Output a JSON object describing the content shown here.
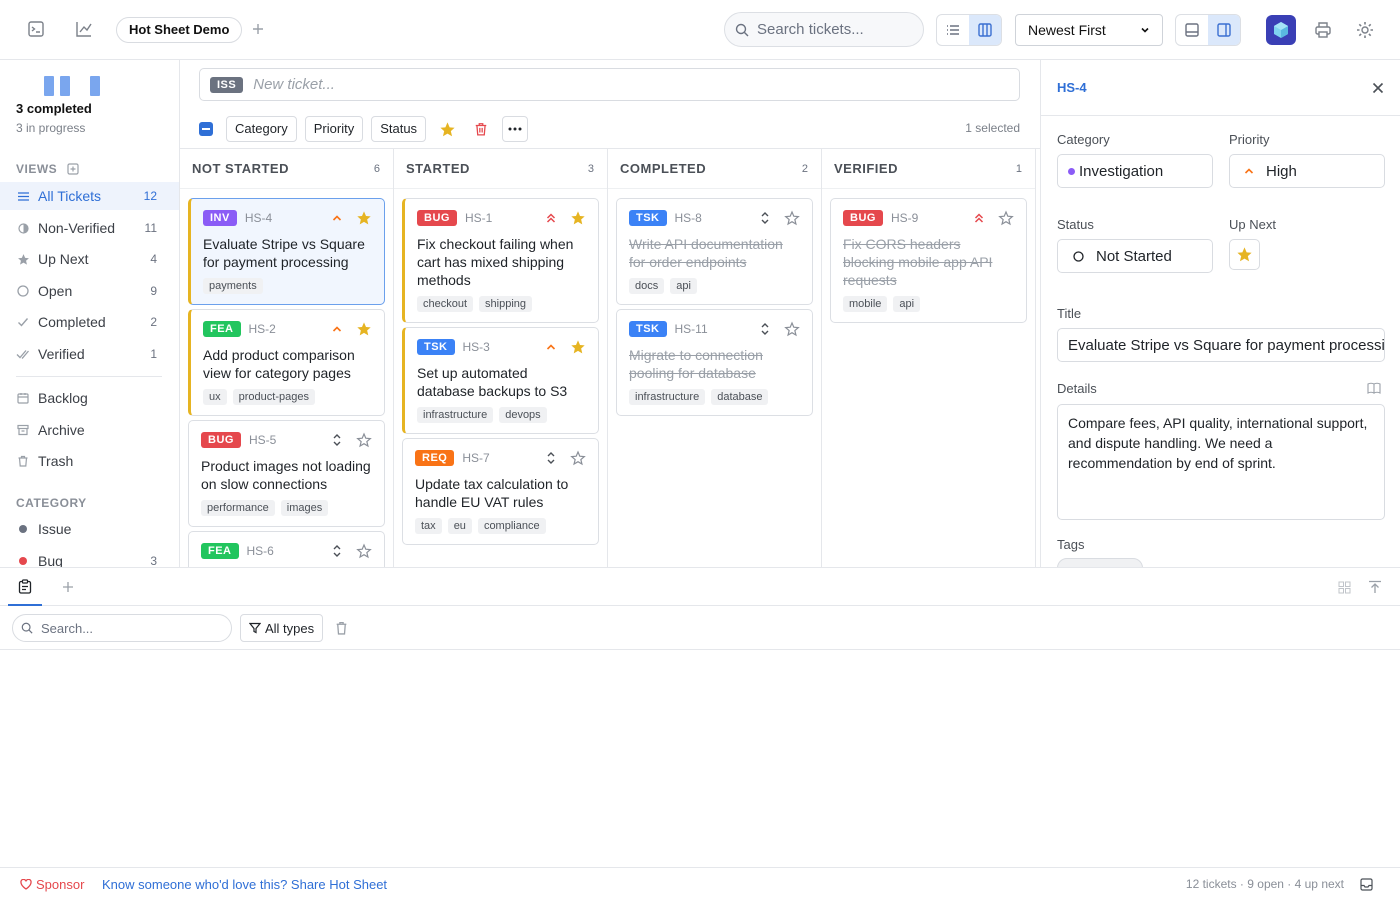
{
  "topbar": {
    "project_tab": "Hot Sheet Demo",
    "search_placeholder": "Search tickets...",
    "sort_value": "Newest First"
  },
  "sidebar": {
    "progress_title": "3 completed",
    "progress_sub": "3 in progress",
    "views_heading": "VIEWS",
    "views": [
      {
        "label": "All Tickets",
        "count": "12",
        "icon": "list-icon"
      },
      {
        "label": "Non-Verified",
        "count": "11",
        "icon": "half-circle-icon"
      },
      {
        "label": "Up Next",
        "count": "4",
        "icon": "star-icon"
      },
      {
        "label": "Open",
        "count": "9",
        "icon": "circle-icon"
      },
      {
        "label": "Completed",
        "count": "2",
        "icon": "check-icon"
      },
      {
        "label": "Verified",
        "count": "1",
        "icon": "double-check-icon"
      }
    ],
    "extra": [
      {
        "label": "Backlog",
        "icon": "calendar-icon"
      },
      {
        "label": "Archive",
        "icon": "archive-icon"
      },
      {
        "label": "Trash",
        "icon": "trash-icon"
      }
    ],
    "category_heading": "CATEGORY",
    "categories": [
      {
        "label": "Issue",
        "count": "",
        "color": "#6b7280"
      },
      {
        "label": "Bug",
        "count": "3",
        "color": "#e5484d"
      }
    ]
  },
  "main": {
    "new_ticket_badge": "ISS",
    "new_ticket_placeholder": "New ticket...",
    "toolbar": {
      "category": "Category",
      "priority": "Priority",
      "status": "Status",
      "selected": "1 selected"
    },
    "columns": [
      {
        "title": "NOT STARTED",
        "count": "6"
      },
      {
        "title": "STARTED",
        "count": "3"
      },
      {
        "title": "COMPLETED",
        "count": "2"
      },
      {
        "title": "VERIFIED",
        "count": "1"
      }
    ],
    "cards": {
      "hs4": {
        "badge": "INV",
        "id": "HS-4",
        "title": "Evaluate Stripe vs Square for payment processing",
        "tags": [
          "payments"
        ]
      },
      "hs2": {
        "badge": "FEA",
        "id": "HS-2",
        "title": "Add product comparison view for category pages",
        "tags": [
          "ux",
          "product-pages"
        ]
      },
      "hs5": {
        "badge": "BUG",
        "id": "HS-5",
        "title": "Product images not loading on slow connections",
        "tags": [
          "performance",
          "images"
        ]
      },
      "hs6": {
        "badge": "FEA",
        "id": "HS-6"
      },
      "hs1": {
        "badge": "BUG",
        "id": "HS-1",
        "title": "Fix checkout failing when cart has mixed shipping methods",
        "tags": [
          "checkout",
          "shipping"
        ]
      },
      "hs3": {
        "badge": "TSK",
        "id": "HS-3",
        "title": "Set up automated database backups to S3",
        "tags": [
          "infrastructure",
          "devops"
        ]
      },
      "hs7": {
        "badge": "REQ",
        "id": "HS-7",
        "title": "Update tax calculation to handle EU VAT rules",
        "tags": [
          "tax",
          "eu",
          "compliance"
        ]
      },
      "hs8": {
        "badge": "TSK",
        "id": "HS-8",
        "title": "Write API documentation for order endpoints",
        "tags": [
          "docs",
          "api"
        ]
      },
      "hs11": {
        "badge": "TSK",
        "id": "HS-11",
        "title": "Migrate to connection pooling for database",
        "tags": [
          "infrastructure",
          "database"
        ]
      },
      "hs9": {
        "badge": "BUG",
        "id": "HS-9",
        "title": "Fix CORS headers blocking mobile app API requests",
        "tags": [
          "mobile",
          "api"
        ]
      }
    },
    "badge_colors": {
      "INV": "#8b5cf6",
      "FEA": "#22c55e",
      "BUG": "#e5484d",
      "TSK": "#3b82f6",
      "REQ": "#f97316"
    }
  },
  "detail": {
    "id": "HS-4",
    "category_label": "Category",
    "category_value": "Investigation",
    "priority_label": "Priority",
    "priority_value": "High",
    "status_label": "Status",
    "status_value": "Not Started",
    "upnext_label": "Up Next",
    "title_label": "Title",
    "title_value": "Evaluate Stripe vs Square for payment processi",
    "details_label": "Details",
    "details_value": "Compare fees, API quality, international support, and dispute handling. We need a recommendation by end of sprint.",
    "tags_label": "Tags"
  },
  "bottom": {
    "search_placeholder": "Search...",
    "types_label": "All types"
  },
  "footer": {
    "sponsor": "Sponsor",
    "share": "Know someone who'd love this? Share Hot Sheet",
    "stats": "12 tickets · 9 open · 4 up next"
  },
  "colors": {
    "accent": "#2f6fd6",
    "star": "#e6b422",
    "priority_high": "#f97316",
    "priority_urgent": "#e5484d"
  }
}
